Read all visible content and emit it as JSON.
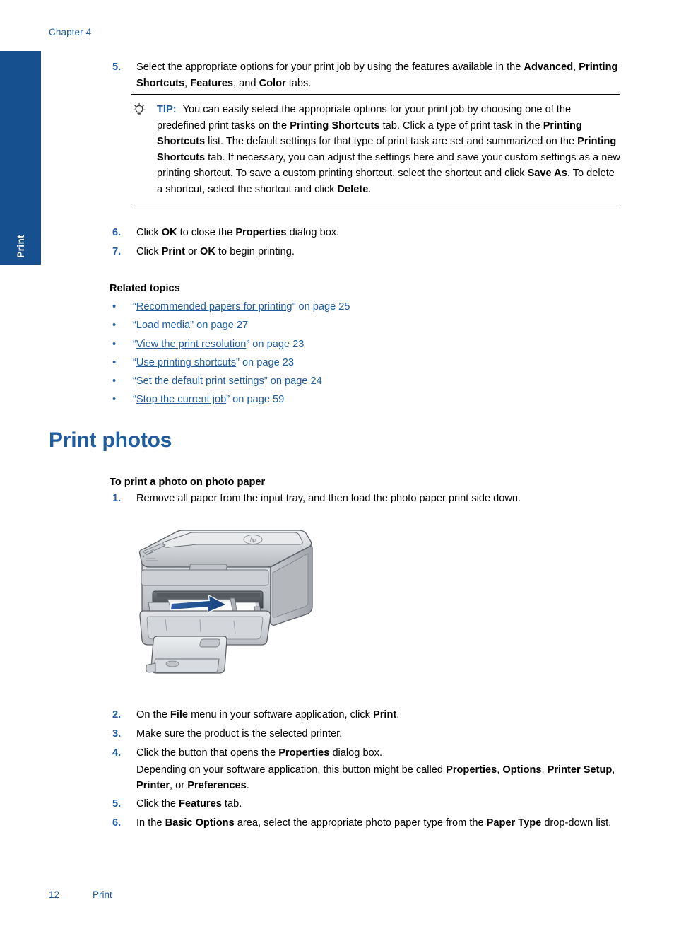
{
  "header": {
    "chapter": "Chapter 4"
  },
  "side_tab": {
    "label": "Print"
  },
  "footer": {
    "page_number": "12",
    "section": "Print"
  },
  "colors": {
    "accent_blue": "#1f5ca0",
    "tab_blue": "#17508f",
    "text_black": "#000000",
    "arrow_blue": "#2a5d9e"
  },
  "steps_top": [
    {
      "num": "5.",
      "html": "Select the appropriate options for your print job by using the features available in the <b>Advanced</b>, <b>Printing Shortcuts</b>, <b>Features</b>, and <b>Color</b> tabs."
    }
  ],
  "tip": {
    "icon": "lightbulb-icon",
    "label": "TIP:",
    "html": "You can easily select the appropriate options for your print job by choosing one of the predefined print tasks on the <b>Printing Shortcuts</b> tab. Click a type of print task in the <b>Printing Shortcuts</b> list. The default settings for that type of print task are set and summarized on the <b>Printing Shortcuts</b> tab. If necessary, you can adjust the settings here and save your custom settings as a new printing shortcut. To save a custom printing shortcut, select the shortcut and click <b>Save As</b>. To delete a shortcut, select the shortcut and click <b>Delete</b>."
  },
  "steps_after_tip": [
    {
      "num": "6.",
      "html": "Click <b>OK</b> to close the <b>Properties</b> dialog box."
    },
    {
      "num": "7.",
      "html": "Click <b>Print</b> or <b>OK</b> to begin printing."
    }
  ],
  "related": {
    "heading": "Related topics",
    "bullet": "•",
    "items": [
      {
        "open_quote": "“",
        "link": "Recommended papers for printing",
        "close_quote": "”",
        "suffix": " on page 25"
      },
      {
        "open_quote": "“",
        "link": "Load media",
        "close_quote": "”",
        "suffix": " on page 27"
      },
      {
        "open_quote": "“",
        "link": "View the print resolution",
        "close_quote": "”",
        "suffix": " on page 23"
      },
      {
        "open_quote": "“",
        "link": "Use printing shortcuts",
        "close_quote": "”",
        "suffix": " on page 23"
      },
      {
        "open_quote": "“",
        "link": "Set the default print settings",
        "close_quote": "”",
        "suffix": " on page 24"
      },
      {
        "open_quote": "“",
        "link": "Stop the current job",
        "close_quote": "”",
        "suffix": " on page 59"
      }
    ]
  },
  "section": {
    "title": "Print photos",
    "procedure_title": "To print a photo on photo paper"
  },
  "steps_photo": [
    {
      "num": "1.",
      "html": "Remove all paper from the input tray, and then load the photo paper print side down."
    }
  ],
  "figure": {
    "name": "hp-all-in-one-printer-illustration",
    "brand_mark": "hp",
    "arrow": "paper-load-direction-arrow"
  },
  "steps_photo_rest": [
    {
      "num": "2.",
      "html": "On the <b>File</b> menu in your software application, click <b>Print</b>."
    },
    {
      "num": "3.",
      "html": "Make sure the product is the selected printer."
    },
    {
      "num": "4.",
      "html": "Click the button that opens the <b>Properties</b> dialog box.",
      "sub_html": "Depending on your software application, this button might be called <b>Properties</b>, <b>Options</b>, <b>Printer Setup</b>, <b>Printer</b>, or <b>Preferences</b>."
    },
    {
      "num": "5.",
      "html": "Click the <b>Features</b> tab."
    },
    {
      "num": "6.",
      "html": "In the <b>Basic Options</b> area, select the appropriate photo paper type from the <b>Paper Type</b> drop-down list."
    }
  ]
}
